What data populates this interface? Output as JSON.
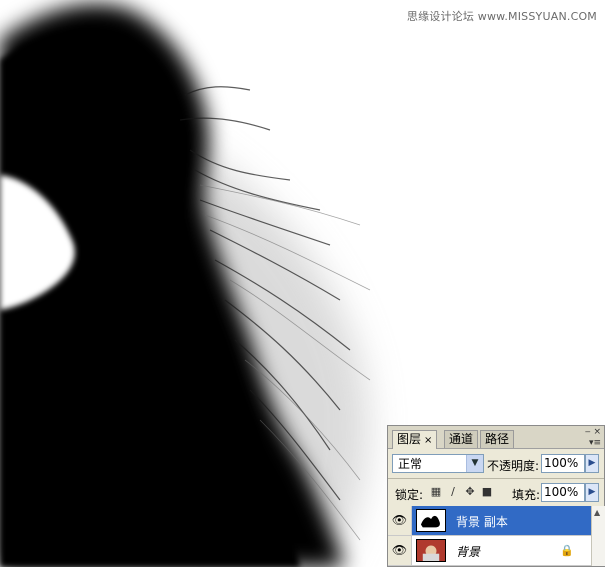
{
  "watermark": "思缘设计论坛  www.MISSYUAN.COM",
  "panel": {
    "tabs": [
      {
        "label": "图层",
        "close": "×"
      },
      {
        "label": "通道"
      },
      {
        "label": "路径"
      }
    ],
    "collapse_glyph": "‒ ×",
    "menu_glyph": "▾≡",
    "blend_mode": "正常",
    "opacity_label": "不透明度:",
    "opacity_value": "100%",
    "lock_label": "锁定:",
    "fill_label": "填充:",
    "fill_value": "100%",
    "layers": [
      {
        "name": "背景 副本",
        "selected": true,
        "icon": "eye-icon"
      },
      {
        "name": "背景",
        "selected": false,
        "icon": "eye-icon",
        "locked": true
      }
    ]
  },
  "icons": {
    "lock_transparent": "checker-icon",
    "lock_paint": "brush-icon",
    "lock_move": "move-icon",
    "lock_all": "lock-icon"
  },
  "colors": {
    "selection": "#316ac5",
    "panel_bg": "#ece9d8"
  }
}
